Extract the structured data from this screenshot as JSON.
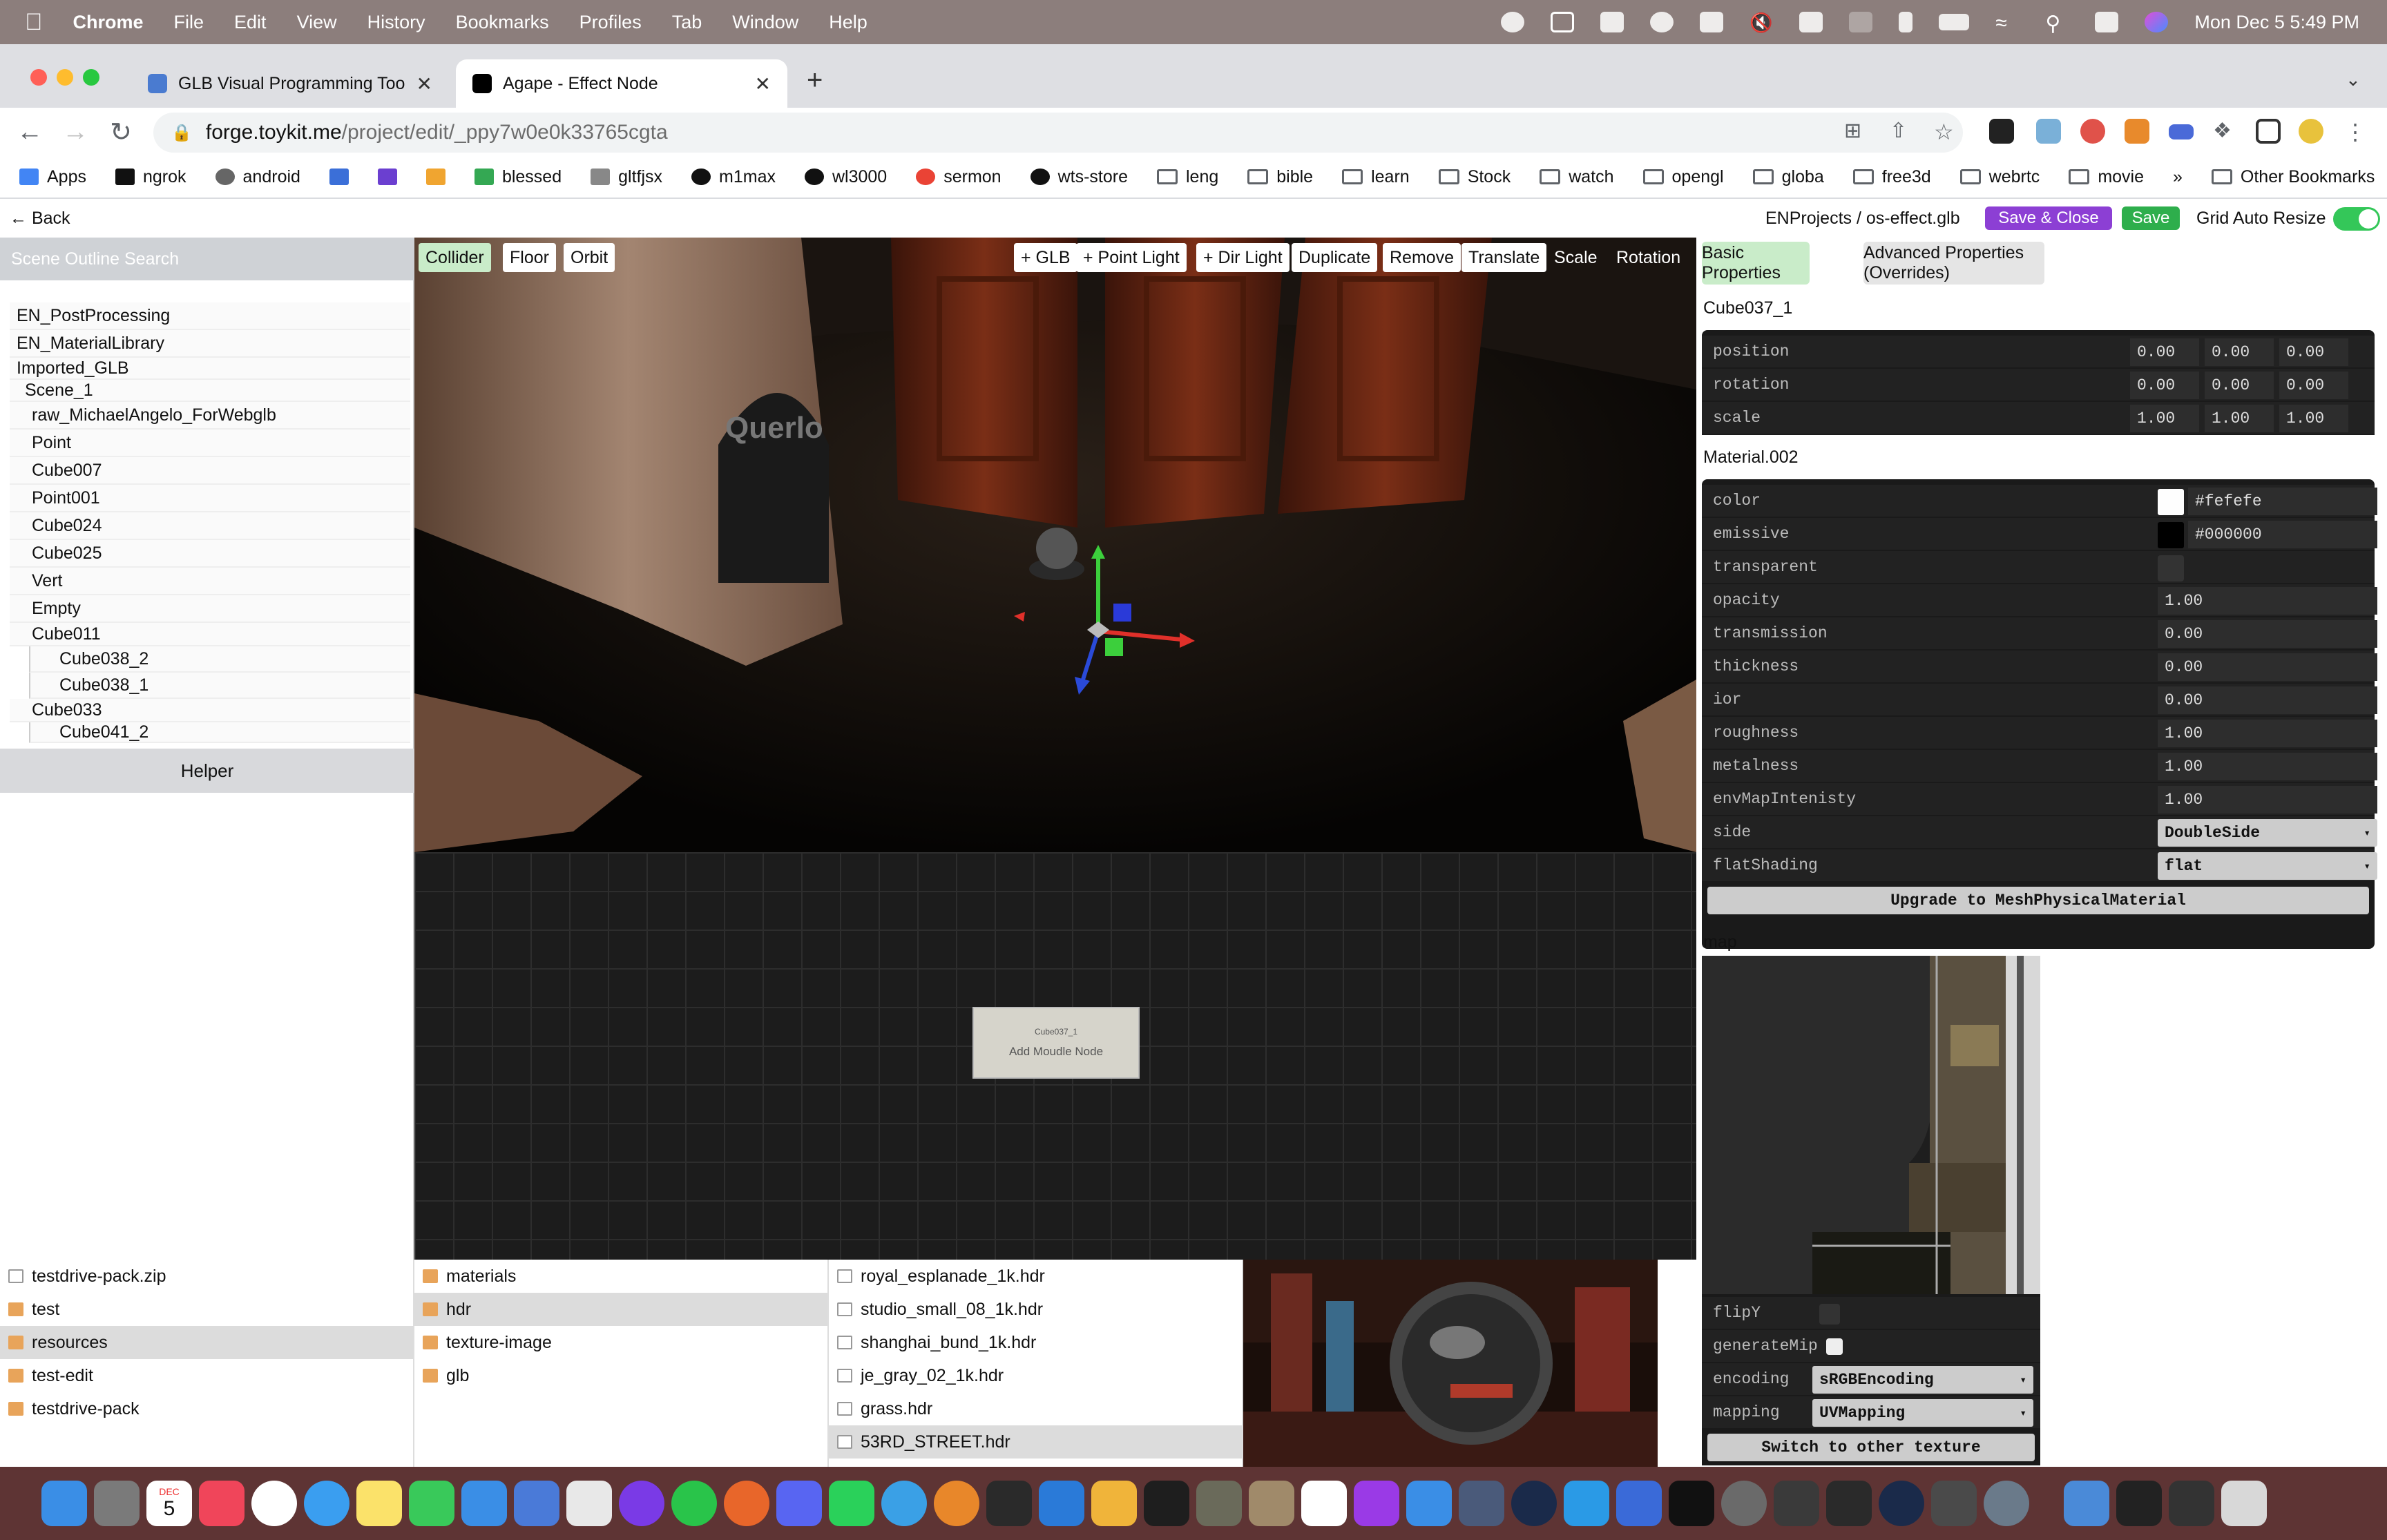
{
  "menubar": {
    "app": "Chrome",
    "items": [
      "File",
      "Edit",
      "View",
      "History",
      "Bookmarks",
      "Profiles",
      "Tab",
      "Window",
      "Help"
    ],
    "clock": "Mon Dec 5  5:49 PM"
  },
  "tabs": [
    {
      "title": "GLB Visual Programming Tool -",
      "favicon_color": "#4a7bd0"
    },
    {
      "title": "Agape - Effect Node",
      "favicon_color": "#000000"
    }
  ],
  "address": {
    "host": "forge.toykit.me",
    "path": "/project/edit/_ppy7w0e0k33765cgta"
  },
  "bookmarks": {
    "items": [
      "Apps",
      "ngrok",
      "android",
      "",
      "",
      "",
      "blessed",
      "gltfjsx",
      "m1max",
      "wl3000",
      "sermon",
      "wts-store",
      "leng",
      "bible",
      "learn",
      "Stock",
      "watch",
      "opengl",
      "globa",
      "free3d",
      "webrtc",
      "movie"
    ],
    "overflow": "»",
    "other": "Other Bookmarks"
  },
  "appbar": {
    "back": "Back",
    "project": "ENProjects  / os-effect.glb",
    "save_close": "Save & Close",
    "save": "Save",
    "grid_auto_resize": "Grid Auto Resize"
  },
  "outline": {
    "search_label": "Scene Outline Search",
    "nodes": [
      "EN_PostProcessing",
      "EN_MaterialLibrary",
      "Imported_GLB",
      "Scene_1",
      "raw_MichaelAngelo_ForWebglb",
      "Point",
      "Cube007",
      "Point001",
      "Cube024",
      "Cube025",
      "Vert",
      "Empty",
      "Cube011",
      "Cube038_2",
      "Cube038_1",
      "Cube033",
      "Cube041_2"
    ],
    "helper": "Helper"
  },
  "viewport": {
    "left_tools": [
      "Collider",
      "Floor",
      "Orbit"
    ],
    "right_tools": [
      "+ GLB",
      "+ Point Light",
      "+ Dir Light",
      "Duplicate",
      "Remove",
      "Translate",
      "Scale",
      "Rotation"
    ],
    "wall_text": "Querlo",
    "module_caption": "Cube037_1",
    "module_label": "Add Moudle Node"
  },
  "properties": {
    "tab_basic": "Basic Properties",
    "tab_advanced": "Advanced Properties (Overrides)",
    "object_name": "Cube037_1",
    "transform": [
      {
        "label": "position",
        "values": [
          "0.00",
          "0.00",
          "0.00"
        ]
      },
      {
        "label": "rotation",
        "values": [
          "0.00",
          "0.00",
          "0.00"
        ]
      },
      {
        "label": "scale",
        "values": [
          "1.00",
          "1.00",
          "1.00"
        ]
      }
    ],
    "material_name": "Material.002",
    "color": {
      "label": "color",
      "hex": "#fefefe"
    },
    "emissive": {
      "label": "emissive",
      "hex": "#000000"
    },
    "transparent": "transparent",
    "numeric": [
      {
        "label": "opacity",
        "value": "1.00"
      },
      {
        "label": "transmission",
        "value": "0.00"
      },
      {
        "label": "thickness",
        "value": "0.00"
      },
      {
        "label": "ior",
        "value": "0.00"
      },
      {
        "label": "roughness",
        "value": "1.00"
      },
      {
        "label": "metalness",
        "value": "1.00"
      },
      {
        "label": "envMapIntenisty",
        "value": "1.00"
      }
    ],
    "side": {
      "label": "side",
      "value": "DoubleSide"
    },
    "flatShading": {
      "label": "flatShading",
      "value": "flat"
    },
    "upgrade": "Upgrade to MeshPhysicalMaterial",
    "map_label": "map",
    "texture": {
      "flipY": "flipY",
      "generateMip": "generateMip",
      "encoding_label": "encoding",
      "encoding": "sRGBEncoding",
      "mapping_label": "mapping",
      "mapping": "UVMapping",
      "switch": "Switch to other texture"
    }
  },
  "files": {
    "col1": [
      "testdrive-pack.zip",
      "test",
      "resources",
      "test-edit",
      "testdrive-pack"
    ],
    "col2": [
      "materials",
      "hdr",
      "texture-image",
      "glb"
    ],
    "col3": [
      "royal_esplanade_1k.hdr",
      "studio_small_08_1k.hdr",
      "shanghai_bund_1k.hdr",
      "je_gray_02_1k.hdr",
      "grass.hdr",
      "53RD_STREET.hdr"
    ]
  },
  "dock": {
    "date_month": "DEC",
    "date_day": "5"
  }
}
